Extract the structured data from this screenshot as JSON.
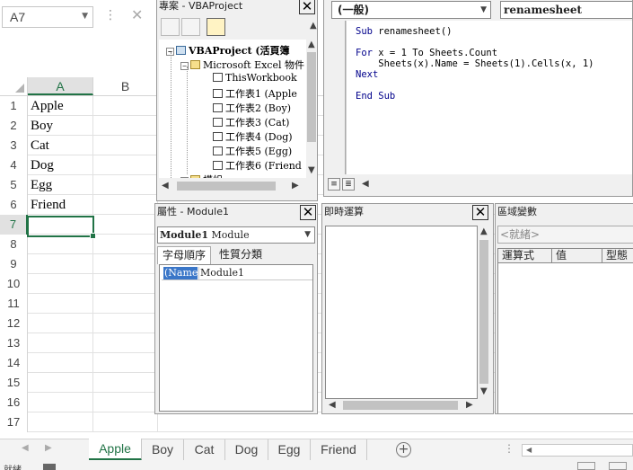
{
  "excel": {
    "name_box": "A7",
    "columns": [
      "A",
      "B"
    ],
    "rows": [
      "1",
      "2",
      "3",
      "4",
      "5",
      "6",
      "7",
      "8",
      "9",
      "10",
      "11",
      "12",
      "13",
      "14",
      "15",
      "16",
      "17"
    ],
    "cells_a": [
      "Apple",
      "Boy",
      "Cat",
      "Dog",
      "Egg",
      "Friend",
      "",
      "",
      "",
      "",
      "",
      "",
      "",
      "",
      "",
      "",
      ""
    ],
    "sheet_tabs": [
      "Apple",
      "Boy",
      "Cat",
      "Dog",
      "Egg",
      "Friend"
    ],
    "active_sheet": "Apple",
    "status_text": "就緒",
    "accent_color": "#217346"
  },
  "project_explorer": {
    "title": "專案 - VBAProject",
    "root": "VBAProject (活頁簿",
    "folder": "Microsoft Excel 物件",
    "items": [
      "ThisWorkbook",
      "工作表1 (Apple",
      "工作表2 (Boy)",
      "工作表3 (Cat)",
      "工作表4 (Dog)",
      "工作表5 (Egg)",
      "工作表6 (Friend"
    ],
    "cut_item": "模組"
  },
  "code_window": {
    "object_combo": "(一般)",
    "proc_combo": "renamesheet",
    "lines": [
      {
        "kw": "Sub",
        "text": " renamesheet()"
      },
      {
        "kw": "",
        "text": ""
      },
      {
        "kw": "For",
        "text": " x = 1 To Sheets.Count"
      },
      {
        "kw": "",
        "text": "    Sheets(x).Name = Sheets(1).Cells(x, 1)"
      },
      {
        "kw": "Next",
        "text": ""
      },
      {
        "kw": "",
        "text": ""
      },
      {
        "kw": "End Sub",
        "text": ""
      }
    ]
  },
  "properties": {
    "title": "屬性 - Module1",
    "object_name": "Module1",
    "object_type": "Module",
    "tab_alpha": "字母順序",
    "tab_category": "性質分類",
    "prop_name": "(Name)",
    "prop_value": "Module1"
  },
  "immediate": {
    "title": "即時運算"
  },
  "locals": {
    "title": "區域變數",
    "context": "<就緒>",
    "headers": [
      "運算式",
      "值",
      "型態"
    ]
  },
  "icons": [
    "close-icon",
    "dropdown-arrow-icon",
    "add-sheet-icon",
    "folder-icon",
    "sheet-object-icon",
    "project-icon"
  ]
}
